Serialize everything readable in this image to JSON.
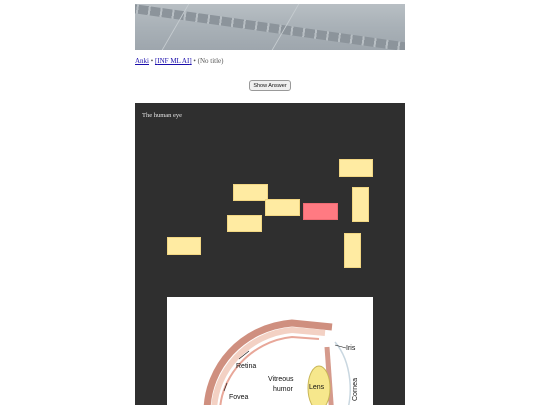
{
  "breadcrumb": {
    "deck": "Anki",
    "separator1": " • ",
    "subdeck": "INF ML AI",
    "separator2": " • ",
    "note_title": "(No title)"
  },
  "actions": {
    "show_answer_label": "Show Answer"
  },
  "card": {
    "title": "The human eye",
    "occlusion_boxes": [
      {
        "id": 1,
        "state": "hidden"
      },
      {
        "id": 2,
        "state": "hidden"
      },
      {
        "id": 3,
        "state": "hidden"
      },
      {
        "id": 4,
        "state": "hidden"
      },
      {
        "id": 5,
        "state": "active"
      },
      {
        "id": 6,
        "state": "hidden"
      },
      {
        "id": 7,
        "state": "hidden"
      },
      {
        "id": 8,
        "state": "hidden"
      }
    ],
    "diagram_labels": {
      "iris": "Iris",
      "retina": "Retina",
      "vitreous_humor_line1": "Vitreous",
      "vitreous_humor_line2": "humor",
      "lens": "Lens",
      "cornea": "Cornea",
      "fovea": "Fovea"
    }
  },
  "colors": {
    "card_background": "#2f2f2f",
    "occlusion_hidden": "#ffeba2",
    "occlusion_active": "#ff7a82",
    "link": "#1a0dab"
  }
}
